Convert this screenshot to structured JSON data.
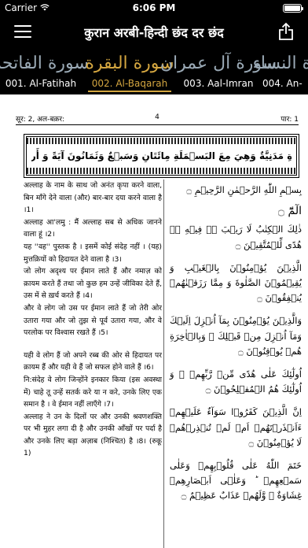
{
  "status": {
    "carrier": "Carrier",
    "time": "6:06 PM"
  },
  "nav": {
    "title": "कुरान अरबी-हिन्दी छंद दर छंद"
  },
  "tabs": [
    {
      "callig": "سورة الفاتحة",
      "label": "001. Al-Fatihah"
    },
    {
      "callig": "سورة البقرة",
      "label": "002. Al-Baqarah"
    },
    {
      "callig": "سورة آل عمران",
      "label": "003. Aal-Imran"
    },
    {
      "callig": "سورة النساء",
      "label": "004. An-"
    }
  ],
  "page": {
    "head_left": "सूर: 2, अल-बक़र:",
    "head_page": "4",
    "head_right": "पार: 1",
    "frame_text": "سُوۡرَةُ البَقَرَةِ مَدَنِيَّةٌ وَهِيَ مِعَ البَسۡمَلَةِ مِائَتَانِ وَسَبۡعٌ وَثَمَانُونَ آيَةً وَ أَرۡبَعُونَ رُكُوعًا",
    "hindi": [
      "अल्लाह के नाम के साथ जो अनंत कृपा करने वाला, बिन माँगे देने वाला (और) बार-बार दया करने वाला है ।1।",
      "अल्लाह आ'लमु : मैं अल्लाह सब से अधिक जानने वाला हूं ।2।",
      "यह ''वह'' पुस्तक है । इसमें कोई संदेह नहीं । (यह) मुत्तक़ियों को हिदायत देने वाला है ।3।",
      "जो लोग अदृश्य पर ईमान लाते हैं और नमाज़ को क़ायम करते हैं तथा जो कुछ हम उन्हें जीविका देते हैं, उस में से ख़र्च करते हैं ।4।",
      "और वे लोग जो उस पर ईमान लाते हैं जो तेरी ओर उतारा गया और जो तुझ से पूर्व उतारा गया, और वे परलोक पर विश्वास रखते हैं ।5।",
      "यही वे लोग हैं जो अपने रब्ब की ओर से हिदायत पर क़ायम हैं और यही वे हैं जो सफल होने वाले हैं ।6।",
      "नि:संदेह वे लोग जिन्होंने इनकार किया (इस अवस्था में) चाहे तू उन्हें सतर्क करे या न करे, उनके लिए एक समान है । वे ईमान नहीं लाएँगे ।7।",
      "अल्लाह ने उन के दिलों पर और उनकी श्रवणशक्ति पर भी मुहर लगा दी है और उनकी आँखों पर पर्दा है और उनके लिए बड़ा अज़ाब (निश्चित) है ।8। (रुकू 1)"
    ],
    "arabic": {
      "basmala": "بِسۡمِ اللّٰهِ الرَّحۡمٰنِ الرَّحِيۡمِ ۝",
      "alm": "الٓمّٓ ۝",
      "verses": [
        "ذٰلِكَ الۡكِتٰبُ لَا رَيۡبَ ۛۚ فِيۡهِ ۛۚ هُدًى لِّلۡمُتَّقِيۡنَ ۝",
        "الَّذِيۡنَ يُؤۡمِنُوۡنَ بِالۡغَيۡبِ وَ يُقِيۡمُوۡنَ الصَّلٰوةَ وَ مِمَّا رَزَقۡنٰهُمۡ يُنۡفِقُوۡنَ ۝",
        "وَالَّذِيۡنَ يُؤۡمِنُوۡنَ بِمَآ اُنۡزِلَ اِلَيۡكَ وَمَآ اُنۡزِلَ مِنۡ قَبۡلِكَ ۚ وَبِالۡاٰخِرَةِ هُمۡ يُوۡقِنُوۡنَ ۝",
        "اُولٰٓئِكَ عَلٰى هُدًى مِّنۡ رَّبِّهِمۡ ۗ وَ اُولٰٓئِكَ هُمُ الۡمُفۡلِحُوۡنَ ۝",
        "اِنَّ الَّذِيۡنَ كَفَرُوۡا سَوَآءٌ عَلَيۡهِمۡ ءَاَنۡذَرۡتَهُمۡ اَمۡ لَمۡ تُنۡذِرۡهُمۡ لَا يُؤۡمِنُوۡنَ ۝",
        "خَتَمَ اللّٰهُ عَلٰى قُلُوۡبِهِمۡ وَعَلٰى سَمۡعِهِمۡ ؕ وَعَلٰۤى اَبۡصَارِهِمۡ غِشَاوَةٌ ۫ وَّلَهُمۡ عَذَابٌ عَظِيۡمٌ ۝"
      ]
    }
  }
}
